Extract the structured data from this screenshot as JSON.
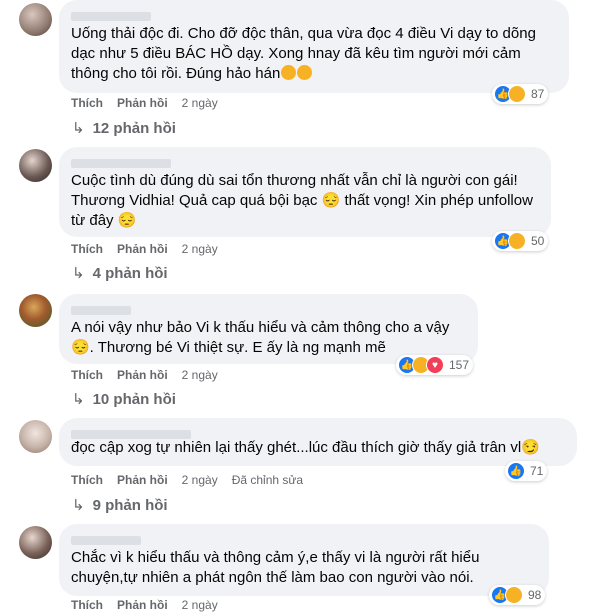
{
  "labels": {
    "like": "Thích",
    "reply": "Phản hồi",
    "edited": "Đã chỉnh sửa"
  },
  "comments": [
    {
      "text": "Uống thải độc đi. Cho đỡ độc thân, qua vừa đọc 4 điều Vi dạy to dõng dạc như 5 điều BÁC HỒ dạy. Xong hnay đã kêu tìm người mới cảm thông cho tôi rồi. Đúng hảo hán",
      "time": "2 ngày",
      "reaction_count": "87",
      "reactions": [
        "like-icon",
        "haha-icon"
      ],
      "replies": "12 phản hồi"
    },
    {
      "text": "Cuộc tình dù đúng dù sai tổn thương nhất vẫn chỉ là người con gái! Thương Vidhia! Quả cap quá bội bạc 😔 thất vọng! Xin phép unfollow từ đây 😔",
      "time": "2 ngày",
      "reaction_count": "50",
      "reactions": [
        "like-icon",
        "sad-icon"
      ],
      "replies": "4 phản hồi"
    },
    {
      "text": "A nói vậy như bảo Vi k thấu hiểu và cảm thông cho a vậy😔. Thương bé Vi thiệt sự. E ấy là ng mạnh mẽ",
      "time": "2 ngày",
      "reaction_count": "157",
      "reactions": [
        "like-icon",
        "sad-icon",
        "love-icon"
      ],
      "replies": "10 phản hồi"
    },
    {
      "text": "đọc cập xog tự nhiên lại thấy ghét...lúc đầu thích giờ thấy giả trân vl😏",
      "time": "2 ngày",
      "reaction_count": "71",
      "reactions": [
        "like-icon"
      ],
      "replies": "9 phản hồi"
    },
    {
      "text": "Chắc vì k hiểu thấu và thông cảm ý,e thấy vi là người rất hiểu chuyện,tự nhiên a phát ngôn thế làm bao con người vào nói.",
      "time": "2 ngày",
      "reaction_count": "98",
      "reactions": [
        "like-icon",
        "haha-icon"
      ],
      "replies": ""
    }
  ]
}
